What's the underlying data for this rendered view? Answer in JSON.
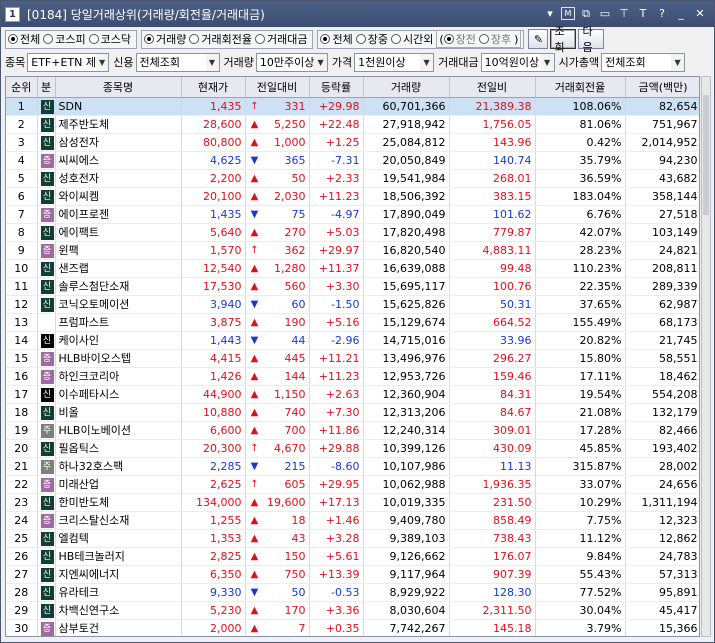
{
  "window": {
    "number": "1",
    "title": "[0184] 당일거래상위(거래량/회전율/거래대금)"
  },
  "title_icons": [
    "chevron-down-icon",
    "m-icon",
    "window-link-icon",
    "save-icon",
    "pin-icon",
    "text-size-icon",
    "help-icon",
    "minimize-icon",
    "close-icon"
  ],
  "title_icon_glyphs": {
    "m": "M",
    "T": "T",
    "q": "?"
  },
  "market_options": [
    {
      "label": "전체",
      "on": true
    },
    {
      "label": "코스피",
      "on": false
    },
    {
      "label": "코스닥",
      "on": false
    }
  ],
  "sort_options": [
    {
      "label": "거래량",
      "on": true
    },
    {
      "label": "거래회전율",
      "on": false
    },
    {
      "label": "거래대금",
      "on": false
    }
  ],
  "session_options": [
    {
      "label": "전체",
      "on": true
    },
    {
      "label": "장중",
      "on": false
    },
    {
      "label": "시간외",
      "on": false
    }
  ],
  "sub_session_options": [
    {
      "label": "장전",
      "on": true
    },
    {
      "label": "장후",
      "on": false
    }
  ],
  "buttons": {
    "query": "조회",
    "next": "다음"
  },
  "filters": {
    "jongmok_label": "종목",
    "jongmok_value": "ETF+ETN 제",
    "credit_label": "신용",
    "credit_value": "전체조회",
    "volume_label": "거래량",
    "volume_value": "10만주이상",
    "price_label": "가격",
    "price_value": "1천원이상",
    "amount_label": "거래대금",
    "amount_value": "10억원이상",
    "cap_label": "시가총액",
    "cap_value": "전체조회"
  },
  "columns": [
    "순위",
    "분",
    "종목명",
    "현재가",
    "전일대비",
    "등락률",
    "거래량",
    "전일비",
    "거래회전율",
    "금액(백만)"
  ],
  "rows": [
    {
      "rank": "1",
      "tag": "신",
      "name": "SDN",
      "price": "1,435",
      "dir": "up-arrow",
      "chg": "331",
      "rate": "+29.98",
      "vol": "60,701,366",
      "prev": "21,389.38",
      "turn": "108.06%",
      "amt": "82,654"
    },
    {
      "rank": "2",
      "tag": "신",
      "name": "제주반도체",
      "price": "28,600",
      "dir": "up",
      "chg": "5,250",
      "rate": "+22.48",
      "vol": "27,918,942",
      "prev": "1,756.05",
      "turn": "81.06%",
      "amt": "751,967"
    },
    {
      "rank": "3",
      "tag": "신",
      "name": "삼성전자",
      "price": "80,800",
      "dir": "up",
      "chg": "1,000",
      "rate": "+1.25",
      "vol": "25,084,812",
      "prev": "143.96",
      "turn": "0.42%",
      "amt": "2,014,952"
    },
    {
      "rank": "4",
      "tag": "증",
      "name": "씨씨에스",
      "price": "4,625",
      "dir": "down",
      "chg": "365",
      "rate": "-7.31",
      "vol": "20,050,849",
      "prev": "140.74",
      "turn": "35.79%",
      "amt": "94,230"
    },
    {
      "rank": "5",
      "tag": "신",
      "name": "성호전자",
      "price": "2,200",
      "dir": "up",
      "chg": "50",
      "rate": "+2.33",
      "vol": "19,541,984",
      "prev": "268.01",
      "turn": "36.59%",
      "amt": "43,682"
    },
    {
      "rank": "6",
      "tag": "신",
      "name": "와이씨켐",
      "price": "20,100",
      "dir": "up",
      "chg": "2,030",
      "rate": "+11.23",
      "vol": "18,506,392",
      "prev": "383.15",
      "turn": "183.04%",
      "amt": "358,144"
    },
    {
      "rank": "7",
      "tag": "증",
      "name": "에이프로젠",
      "price": "1,435",
      "dir": "down",
      "chg": "75",
      "rate": "-4.97",
      "vol": "17,890,049",
      "prev": "101.62",
      "turn": "6.76%",
      "amt": "27,518"
    },
    {
      "rank": "8",
      "tag": "신",
      "name": "에이팩트",
      "price": "5,640",
      "dir": "up",
      "chg": "270",
      "rate": "+5.03",
      "vol": "17,820,498",
      "prev": "779.87",
      "turn": "42.07%",
      "amt": "103,149"
    },
    {
      "rank": "9",
      "tag": "증",
      "name": "윈팩",
      "price": "1,570",
      "dir": "up-arrow",
      "chg": "362",
      "rate": "+29.97",
      "vol": "16,820,540",
      "prev": "4,883.11",
      "turn": "28.23%",
      "amt": "24,821"
    },
    {
      "rank": "10",
      "tag": "신",
      "name": "샌즈랩",
      "price": "12,540",
      "dir": "up",
      "chg": "1,280",
      "rate": "+11.37",
      "vol": "16,639,088",
      "prev": "99.48",
      "turn": "110.23%",
      "amt": "208,811"
    },
    {
      "rank": "11",
      "tag": "신",
      "name": "솔루스첨단소재",
      "price": "17,530",
      "dir": "up",
      "chg": "560",
      "rate": "+3.30",
      "vol": "15,695,117",
      "prev": "100.76",
      "turn": "22.35%",
      "amt": "289,339"
    },
    {
      "rank": "12",
      "tag": "신",
      "name": "코닉오토메이션",
      "price": "3,940",
      "dir": "down",
      "chg": "60",
      "rate": "-1.50",
      "vol": "15,625,826",
      "prev": "50.31",
      "turn": "37.65%",
      "amt": "62,987"
    },
    {
      "rank": "13",
      "tag": "",
      "name": "프럼파스트",
      "price": "3,875",
      "dir": "up",
      "chg": "190",
      "rate": "+5.16",
      "vol": "15,129,674",
      "prev": "664.52",
      "turn": "155.49%",
      "amt": "68,173"
    },
    {
      "rank": "14",
      "tag": "신2",
      "name": "케이사인",
      "price": "1,443",
      "dir": "down",
      "chg": "44",
      "rate": "-2.96",
      "vol": "14,715,016",
      "prev": "33.96",
      "turn": "20.82%",
      "amt": "21,745"
    },
    {
      "rank": "15",
      "tag": "증",
      "name": "HLB바이오스텝",
      "price": "4,415",
      "dir": "up",
      "chg": "445",
      "rate": "+11.21",
      "vol": "13,496,976",
      "prev": "296.27",
      "turn": "15.80%",
      "amt": "58,551"
    },
    {
      "rank": "16",
      "tag": "증",
      "name": "하인크코리아",
      "price": "1,426",
      "dir": "up",
      "chg": "144",
      "rate": "+11.23",
      "vol": "12,953,726",
      "prev": "159.46",
      "turn": "17.11%",
      "amt": "18,462"
    },
    {
      "rank": "17",
      "tag": "신2",
      "name": "이수페타시스",
      "price": "44,900",
      "dir": "up",
      "chg": "1,150",
      "rate": "+2.63",
      "vol": "12,360,904",
      "prev": "84.31",
      "turn": "19.54%",
      "amt": "554,208"
    },
    {
      "rank": "18",
      "tag": "신",
      "name": "비올",
      "price": "10,880",
      "dir": "up",
      "chg": "740",
      "rate": "+7.30",
      "vol": "12,313,206",
      "prev": "84.67",
      "turn": "21.08%",
      "amt": "132,179"
    },
    {
      "rank": "19",
      "tag": "주",
      "name": "HLB이노베이션",
      "price": "6,600",
      "dir": "up",
      "chg": "700",
      "rate": "+11.86",
      "vol": "12,240,314",
      "prev": "309.01",
      "turn": "17.28%",
      "amt": "82,466"
    },
    {
      "rank": "20",
      "tag": "신",
      "name": "필옵틱스",
      "price": "20,300",
      "dir": "up-arrow",
      "chg": "4,670",
      "rate": "+29.88",
      "vol": "10,399,126",
      "prev": "430.09",
      "turn": "45.85%",
      "amt": "193,402"
    },
    {
      "rank": "21",
      "tag": "주",
      "name": "하나32호스팩",
      "price": "2,285",
      "dir": "down",
      "chg": "215",
      "rate": "-8.60",
      "vol": "10,107,986",
      "prev": "11.13",
      "turn": "315.87%",
      "amt": "28,002"
    },
    {
      "rank": "22",
      "tag": "증",
      "name": "미래산업",
      "price": "2,625",
      "dir": "up-arrow",
      "chg": "605",
      "rate": "+29.95",
      "vol": "10,062,988",
      "prev": "1,936.35",
      "turn": "33.07%",
      "amt": "24,656"
    },
    {
      "rank": "23",
      "tag": "신",
      "name": "한미반도체",
      "price": "134,000",
      "dir": "up",
      "chg": "19,600",
      "rate": "+17.13",
      "vol": "10,019,335",
      "prev": "231.50",
      "turn": "10.29%",
      "amt": "1,311,194"
    },
    {
      "rank": "24",
      "tag": "증",
      "name": "크리스탈신소재",
      "price": "1,255",
      "dir": "up",
      "chg": "18",
      "rate": "+1.46",
      "vol": "9,409,780",
      "prev": "858.49",
      "turn": "7.75%",
      "amt": "12,323"
    },
    {
      "rank": "25",
      "tag": "신",
      "name": "엘컴텍",
      "price": "1,353",
      "dir": "up",
      "chg": "43",
      "rate": "+3.28",
      "vol": "9,389,103",
      "prev": "738.43",
      "turn": "11.12%",
      "amt": "12,862"
    },
    {
      "rank": "26",
      "tag": "신",
      "name": "HB테크놀러지",
      "price": "2,825",
      "dir": "up",
      "chg": "150",
      "rate": "+5.61",
      "vol": "9,126,662",
      "prev": "176.07",
      "turn": "9.84%",
      "amt": "24,783"
    },
    {
      "rank": "27",
      "tag": "신",
      "name": "지엔씨에너지",
      "price": "6,350",
      "dir": "up",
      "chg": "750",
      "rate": "+13.39",
      "vol": "9,117,964",
      "prev": "907.39",
      "turn": "55.43%",
      "amt": "57,313"
    },
    {
      "rank": "28",
      "tag": "신",
      "name": "유라테크",
      "price": "9,330",
      "dir": "down",
      "chg": "50",
      "rate": "-0.53",
      "vol": "8,929,922",
      "prev": "128.30",
      "turn": "77.52%",
      "amt": "95,891"
    },
    {
      "rank": "29",
      "tag": "신",
      "name": "차백신연구소",
      "price": "5,230",
      "dir": "up",
      "chg": "170",
      "rate": "+3.36",
      "vol": "8,030,604",
      "prev": "2,311.50",
      "turn": "30.04%",
      "amt": "45,417"
    },
    {
      "rank": "30",
      "tag": "증",
      "name": "삼부토건",
      "price": "2,000",
      "dir": "up",
      "chg": "7",
      "rate": "+0.35",
      "vol": "7,742,267",
      "prev": "145.18",
      "turn": "3.79%",
      "amt": "15,366"
    }
  ],
  "tag_display": {
    "신": "신",
    "증": "증",
    "주": "주",
    "신2": "신"
  },
  "colors": {
    "up": "#e0101a",
    "down": "#1838d0",
    "selected_row": "#cde0f4",
    "title_bar": "#3c4d70"
  },
  "arrow_glyphs": {
    "up-arrow": "↑",
    "up": "▲",
    "down": "▼"
  }
}
